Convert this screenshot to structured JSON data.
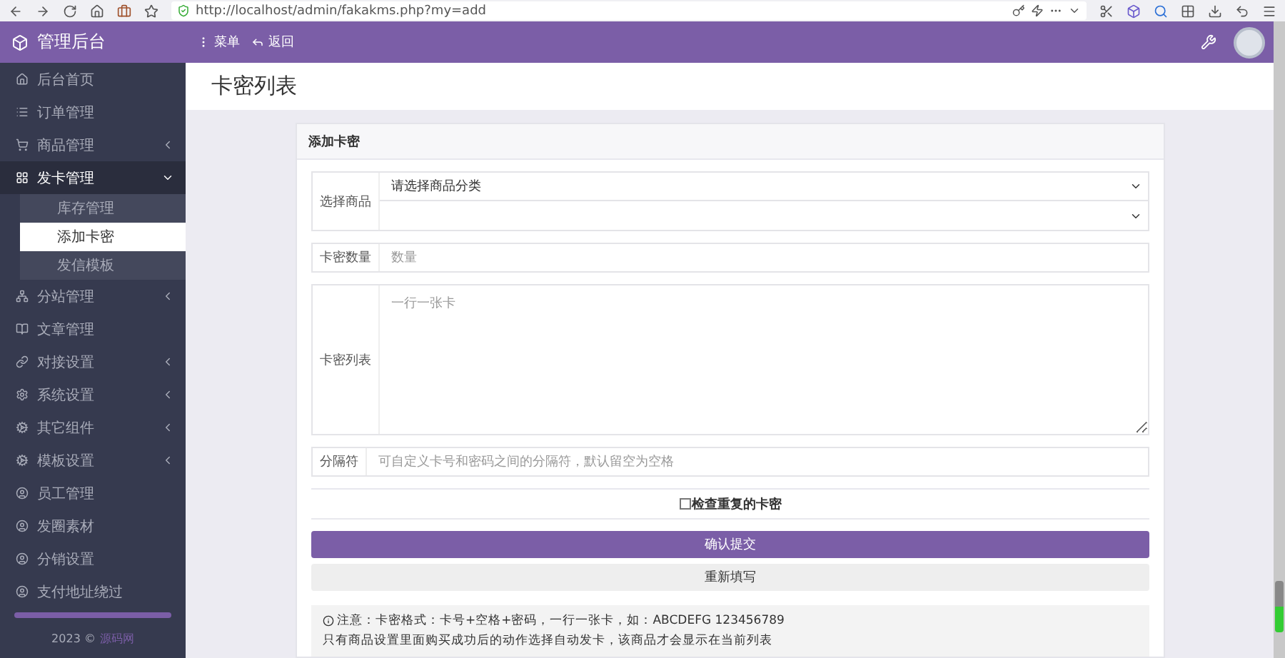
{
  "browser": {
    "url": "http://localhost/admin/fakakms.php?my=add"
  },
  "header": {
    "brand": "管理后台",
    "menu_label": "菜单",
    "back_label": "返回"
  },
  "sidebar": {
    "items": [
      {
        "label": "后台首页",
        "selected": false
      },
      {
        "label": "订单管理",
        "selected": false
      },
      {
        "label": "商品管理",
        "selected": false,
        "expanded": false
      },
      {
        "label": "发卡管理",
        "selected": false,
        "expanded": true,
        "children": [
          {
            "label": "库存管理",
            "selected": false
          },
          {
            "label": "添加卡密",
            "selected": true
          },
          {
            "label": "发信模板",
            "selected": false
          }
        ]
      },
      {
        "label": "分站管理",
        "selected": false,
        "expanded": false
      },
      {
        "label": "文章管理",
        "selected": false
      },
      {
        "label": "对接设置",
        "selected": false,
        "expanded": false
      },
      {
        "label": "系统设置",
        "selected": false,
        "expanded": false
      },
      {
        "label": "其它组件",
        "selected": false,
        "expanded": false
      },
      {
        "label": "模板设置",
        "selected": false,
        "expanded": false
      },
      {
        "label": "员工管理",
        "selected": false
      },
      {
        "label": "发圈素材",
        "selected": false
      },
      {
        "label": "分销设置",
        "selected": false
      },
      {
        "label": "支付地址绕过",
        "selected": false
      }
    ],
    "footer": {
      "year": "2023 ©",
      "link": "源码网"
    }
  },
  "page_title": "卡密列表",
  "form": {
    "title": "添加卡密",
    "product": {
      "label": "选择商品",
      "category_value": "请选择商品分类"
    },
    "quantity": {
      "label": "卡密数量",
      "placeholder": "数量"
    },
    "cards": {
      "label": "卡密列表",
      "placeholder": "一行一张卡"
    },
    "separator": {
      "label": "分隔符",
      "placeholder": "可自定义卡号和密码之间的分隔符，默认留空为空格"
    },
    "check_duplicates": {
      "label": "检查重复的卡密",
      "checked": false
    },
    "submit": "确认提交",
    "reset": "重新填写",
    "notes": [
      "注意：卡密格式：卡号+空格+密码，一行一张卡，如：ABCDEFG 123456789",
      "只有商品设置里面购买成功后的动作选择自动发卡，该商品才会显示在当前列表"
    ]
  }
}
